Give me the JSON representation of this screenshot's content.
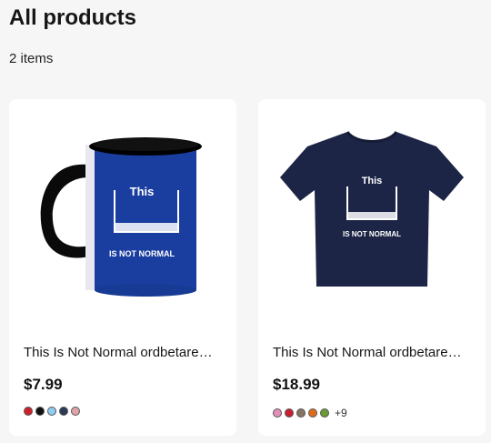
{
  "page": {
    "title": "All products",
    "item_count": "2 items"
  },
  "products": [
    {
      "title": "This Is Not Normal ordbetare…",
      "price": "$7.99",
      "image_icon": "mug-image",
      "image_text": {
        "headline": "This",
        "subline": "IS NOT NORMAL"
      },
      "colors": [
        "#d01f2a",
        "#111111",
        "#8ecdf0",
        "#2b3a55",
        "#e0a3a8"
      ],
      "more": ""
    },
    {
      "title": "This Is Not Normal ordbetare…",
      "price": "$18.99",
      "image_icon": "tshirt-image",
      "image_text": {
        "headline": "This",
        "subline": "IS NOT NORMAL"
      },
      "colors": [
        "#e58fb7",
        "#c8202e",
        "#857461",
        "#e06a1b",
        "#6b9a34"
      ],
      "more": "+9"
    }
  ]
}
